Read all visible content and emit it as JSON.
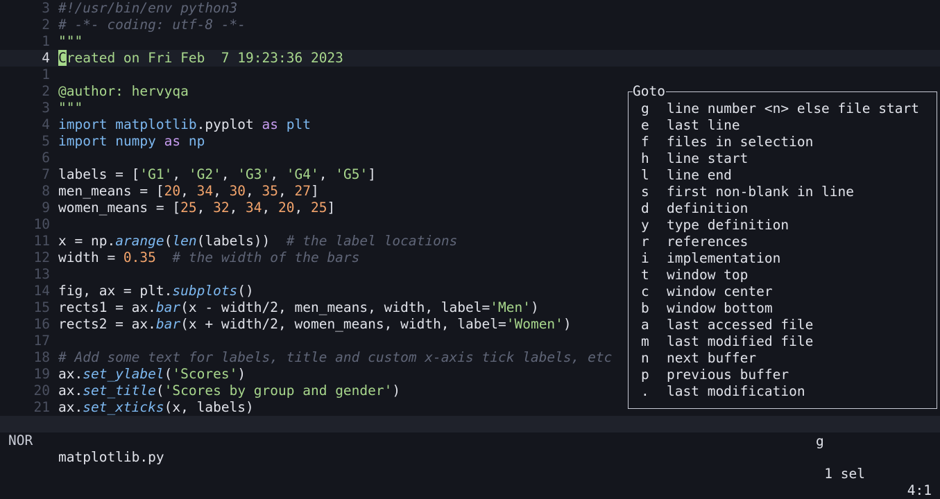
{
  "editor": {
    "lines": [
      {
        "num": "3",
        "current": false,
        "tokens": [
          {
            "t": "#!/usr/bin/env python3",
            "c": "shebang"
          }
        ]
      },
      {
        "num": "2",
        "current": false,
        "tokens": [
          {
            "t": "# -*- coding: utf-8 -*-",
            "c": "comment"
          }
        ]
      },
      {
        "num": "1",
        "current": false,
        "tokens": [
          {
            "t": "\"\"\"",
            "c": "string"
          }
        ]
      },
      {
        "num": "4",
        "current": true,
        "tokens": [
          {
            "t": "C",
            "c": "cursor"
          },
          {
            "t": "reated on Fri Feb  7 19:23:36 2023",
            "c": "string"
          }
        ]
      },
      {
        "num": "1",
        "current": false,
        "tokens": []
      },
      {
        "num": "2",
        "current": false,
        "tokens": [
          {
            "t": "@author: hervyqa",
            "c": "string"
          }
        ]
      },
      {
        "num": "3",
        "current": false,
        "tokens": [
          {
            "t": "\"\"\"",
            "c": "string"
          }
        ]
      },
      {
        "num": "4",
        "current": false,
        "tokens": [
          {
            "t": "import",
            "c": "module"
          },
          {
            "t": " ",
            "c": "plain"
          },
          {
            "t": "matplotlib",
            "c": "module"
          },
          {
            "t": ".pyplot ",
            "c": "plain"
          },
          {
            "t": "as",
            "c": "keyword"
          },
          {
            "t": " ",
            "c": "plain"
          },
          {
            "t": "plt",
            "c": "module"
          }
        ]
      },
      {
        "num": "5",
        "current": false,
        "tokens": [
          {
            "t": "import",
            "c": "module"
          },
          {
            "t": " ",
            "c": "plain"
          },
          {
            "t": "numpy",
            "c": "module"
          },
          {
            "t": " ",
            "c": "plain"
          },
          {
            "t": "as",
            "c": "keyword"
          },
          {
            "t": " ",
            "c": "plain"
          },
          {
            "t": "np",
            "c": "module"
          }
        ]
      },
      {
        "num": "6",
        "current": false,
        "tokens": []
      },
      {
        "num": "7",
        "current": false,
        "tokens": [
          {
            "t": "labels = [",
            "c": "plain"
          },
          {
            "t": "'G1'",
            "c": "string"
          },
          {
            "t": ", ",
            "c": "plain"
          },
          {
            "t": "'G2'",
            "c": "string"
          },
          {
            "t": ", ",
            "c": "plain"
          },
          {
            "t": "'G3'",
            "c": "string"
          },
          {
            "t": ", ",
            "c": "plain"
          },
          {
            "t": "'G4'",
            "c": "string"
          },
          {
            "t": ", ",
            "c": "plain"
          },
          {
            "t": "'G5'",
            "c": "string"
          },
          {
            "t": "]",
            "c": "plain"
          }
        ]
      },
      {
        "num": "8",
        "current": false,
        "tokens": [
          {
            "t": "men_means = [",
            "c": "plain"
          },
          {
            "t": "20",
            "c": "number"
          },
          {
            "t": ", ",
            "c": "plain"
          },
          {
            "t": "34",
            "c": "number"
          },
          {
            "t": ", ",
            "c": "plain"
          },
          {
            "t": "30",
            "c": "number"
          },
          {
            "t": ", ",
            "c": "plain"
          },
          {
            "t": "35",
            "c": "number"
          },
          {
            "t": ", ",
            "c": "plain"
          },
          {
            "t": "27",
            "c": "number"
          },
          {
            "t": "]",
            "c": "plain"
          }
        ]
      },
      {
        "num": "9",
        "current": false,
        "tokens": [
          {
            "t": "women_means = [",
            "c": "plain"
          },
          {
            "t": "25",
            "c": "number"
          },
          {
            "t": ", ",
            "c": "plain"
          },
          {
            "t": "32",
            "c": "number"
          },
          {
            "t": ", ",
            "c": "plain"
          },
          {
            "t": "34",
            "c": "number"
          },
          {
            "t": ", ",
            "c": "plain"
          },
          {
            "t": "20",
            "c": "number"
          },
          {
            "t": ", ",
            "c": "plain"
          },
          {
            "t": "25",
            "c": "number"
          },
          {
            "t": "]",
            "c": "plain"
          }
        ]
      },
      {
        "num": "10",
        "current": false,
        "tokens": []
      },
      {
        "num": "11",
        "current": false,
        "tokens": [
          {
            "t": "x = np.",
            "c": "plain"
          },
          {
            "t": "arange",
            "c": "func"
          },
          {
            "t": "(",
            "c": "plain"
          },
          {
            "t": "len",
            "c": "builtin"
          },
          {
            "t": "(labels))  ",
            "c": "plain"
          },
          {
            "t": "# the label locations",
            "c": "comment"
          }
        ]
      },
      {
        "num": "12",
        "current": false,
        "tokens": [
          {
            "t": "width = ",
            "c": "plain"
          },
          {
            "t": "0.35",
            "c": "number"
          },
          {
            "t": "  ",
            "c": "plain"
          },
          {
            "t": "# the width of the bars",
            "c": "comment"
          }
        ]
      },
      {
        "num": "13",
        "current": false,
        "tokens": []
      },
      {
        "num": "14",
        "current": false,
        "tokens": [
          {
            "t": "fig, ax = plt.",
            "c": "plain"
          },
          {
            "t": "subplots",
            "c": "func"
          },
          {
            "t": "()",
            "c": "plain"
          }
        ]
      },
      {
        "num": "15",
        "current": false,
        "tokens": [
          {
            "t": "rects1 = ax.",
            "c": "plain"
          },
          {
            "t": "bar",
            "c": "func"
          },
          {
            "t": "(x - width/2, men_means, width, label=",
            "c": "plain"
          },
          {
            "t": "'Men'",
            "c": "string"
          },
          {
            "t": ")",
            "c": "plain"
          }
        ]
      },
      {
        "num": "16",
        "current": false,
        "tokens": [
          {
            "t": "rects2 = ax.",
            "c": "plain"
          },
          {
            "t": "bar",
            "c": "func"
          },
          {
            "t": "(x + width/2, women_means, width, label=",
            "c": "plain"
          },
          {
            "t": "'Women'",
            "c": "string"
          },
          {
            "t": ")",
            "c": "plain"
          }
        ]
      },
      {
        "num": "17",
        "current": false,
        "tokens": []
      },
      {
        "num": "18",
        "current": false,
        "tokens": [
          {
            "t": "# Add some text for labels, title and custom x-axis tick labels, etc",
            "c": "comment"
          }
        ]
      },
      {
        "num": "19",
        "current": false,
        "tokens": [
          {
            "t": "ax.",
            "c": "plain"
          },
          {
            "t": "set_ylabel",
            "c": "func"
          },
          {
            "t": "(",
            "c": "plain"
          },
          {
            "t": "'Scores'",
            "c": "string"
          },
          {
            "t": ")",
            "c": "plain"
          }
        ]
      },
      {
        "num": "20",
        "current": false,
        "tokens": [
          {
            "t": "ax.",
            "c": "plain"
          },
          {
            "t": "set_title",
            "c": "func"
          },
          {
            "t": "(",
            "c": "plain"
          },
          {
            "t": "'Scores by group and gender'",
            "c": "string"
          },
          {
            "t": ")",
            "c": "plain"
          }
        ]
      },
      {
        "num": "21",
        "current": false,
        "tokens": [
          {
            "t": "ax.",
            "c": "plain"
          },
          {
            "t": "set_xticks",
            "c": "func"
          },
          {
            "t": "(x, labels)",
            "c": "plain"
          }
        ]
      }
    ]
  },
  "popup": {
    "title": "Goto",
    "items": [
      {
        "key": "g",
        "desc": "line number <n> else file start"
      },
      {
        "key": "e",
        "desc": "last line"
      },
      {
        "key": "f",
        "desc": "files in selection"
      },
      {
        "key": "h",
        "desc": "line start"
      },
      {
        "key": "l",
        "desc": "line end"
      },
      {
        "key": "s",
        "desc": "first non-blank in line"
      },
      {
        "key": "d",
        "desc": "definition"
      },
      {
        "key": "y",
        "desc": "type definition"
      },
      {
        "key": "r",
        "desc": "references"
      },
      {
        "key": "i",
        "desc": "implementation"
      },
      {
        "key": "t",
        "desc": "window top"
      },
      {
        "key": "c",
        "desc": "window center"
      },
      {
        "key": "b",
        "desc": "window bottom"
      },
      {
        "key": "a",
        "desc": "last accessed file"
      },
      {
        "key": "m",
        "desc": "last modified file"
      },
      {
        "key": "n",
        "desc": "next buffer"
      },
      {
        "key": "p",
        "desc": "previous buffer"
      },
      {
        "key": ".",
        "desc": "last modification"
      }
    ]
  },
  "statusline": {
    "mode": "NOR",
    "filename": "matplotlib.py",
    "selections": "1 sel",
    "position": "4:1"
  },
  "cmdline": {
    "pending_keys": "g"
  }
}
